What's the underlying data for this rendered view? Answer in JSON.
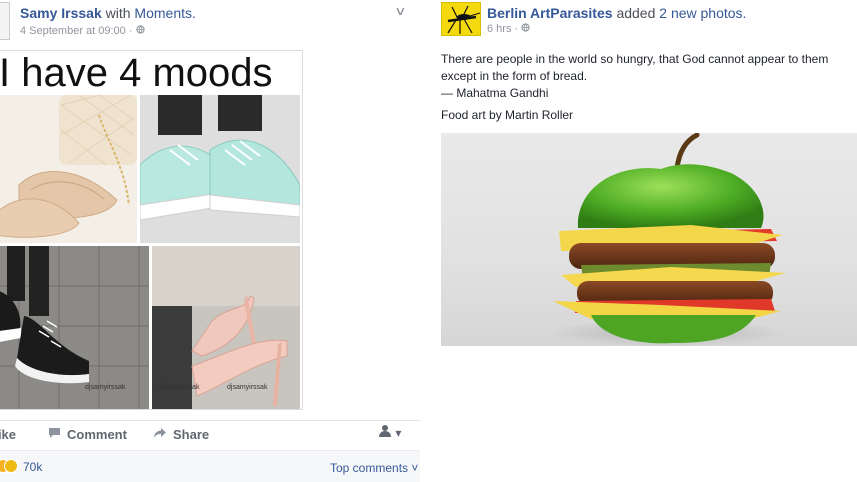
{
  "left_post": {
    "author": "Samy Irssak",
    "author_connector": "with",
    "author_with": "Moments.",
    "timestamp": "4 September at 09:00",
    "privacy_icon": "globe-icon",
    "options_icon": "chevron-down-icon",
    "image": {
      "headline": "I have 4 moods",
      "watermark_handles": [
        "djsamyirssak",
        "djsamyirssak",
        "djsamyirssak"
      ]
    },
    "actions": {
      "like": "Like",
      "comment": "Comment",
      "share": "Share"
    },
    "reactions_count": "70k",
    "top_comments": "Top comments ˅"
  },
  "right_post": {
    "page_name": "Berlin ArtParasites",
    "activity": "added",
    "activity_target": "2 new photos.",
    "timestamp": "6 hrs",
    "privacy_icon": "globe-icon",
    "quote_lines": [
      "There are people in the world so hungry, that God cannot appear to them",
      "except in the form of bread.",
      "— Mahatma Gandhi"
    ],
    "credit": "Food art by Martin Roller"
  },
  "colors": {
    "link": "#365899",
    "meta": "#90949c",
    "apple_green": "#5cb82e",
    "page_avatar_yellow": "#f4d90f"
  }
}
